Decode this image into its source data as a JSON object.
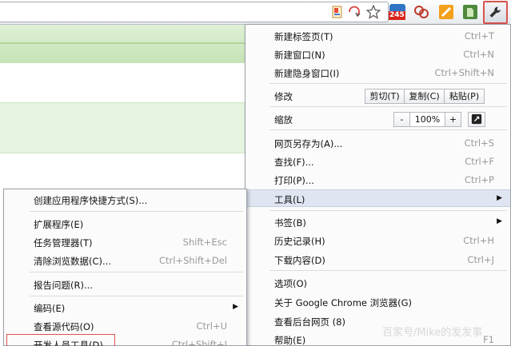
{
  "toolbar": {
    "icons": [
      "page-action-icon",
      "star-bookmark-icon"
    ],
    "extensions": [
      "weather-ext-icon",
      "kingsoft-ext-icon",
      "rss-ext-icon",
      "evernote-ext-icon"
    ],
    "badge": "245",
    "wrench_icon": "wrench-icon",
    "colors": {
      "highlight_border": "#d9534f"
    }
  },
  "main_menu": {
    "new_tab": "新建标签页(T)",
    "new_tab_sc": "Ctrl+T",
    "new_window": "新建窗口(N)",
    "new_window_sc": "Ctrl+N",
    "new_incognito": "新建隐身窗口(I)",
    "new_incognito_sc": "Ctrl+Shift+N",
    "edit": "修改",
    "cut": "剪切(T)",
    "copy": "复制(C)",
    "paste": "粘贴(P)",
    "zoom": "缩放",
    "zoom_minus": "-",
    "zoom_value": "100%",
    "zoom_plus": "+",
    "save_as": "网页另存为(A)...",
    "save_as_sc": "Ctrl+S",
    "find": "查找(F)...",
    "find_sc": "Ctrl+F",
    "print": "打印(P)...",
    "print_sc": "Ctrl+P",
    "tools": "工具(L)",
    "bookmarks": "书签(B)",
    "history": "历史记录(H)",
    "history_sc": "Ctrl+H",
    "downloads": "下载内容(D)",
    "downloads_sc": "Ctrl+J",
    "options": "选项(O)",
    "about": "关于 Google Chrome 浏览器(G)",
    "background_pages": "查看后台网页 (8)",
    "help": "帮助(E)",
    "help_sc": "F1"
  },
  "tools_menu": {
    "create_shortcuts": "创建应用程序快捷方式(S)...",
    "extensions": "扩展程序(E)",
    "task_manager": "任务管理器(T)",
    "task_manager_sc": "Shift+Esc",
    "clear_data": "清除浏览数据(C)...",
    "clear_data_sc": "Ctrl+Shift+Del",
    "report_issue": "报告问题(R)...",
    "encoding": "编码(E)",
    "view_source": "查看源代码(O)",
    "view_source_sc": "Ctrl+U",
    "dev_tools": "开发人员工具(D)",
    "dev_tools_sc": "Ctrl+Shift+I"
  },
  "watermark": "百家号/Mike的发发事"
}
